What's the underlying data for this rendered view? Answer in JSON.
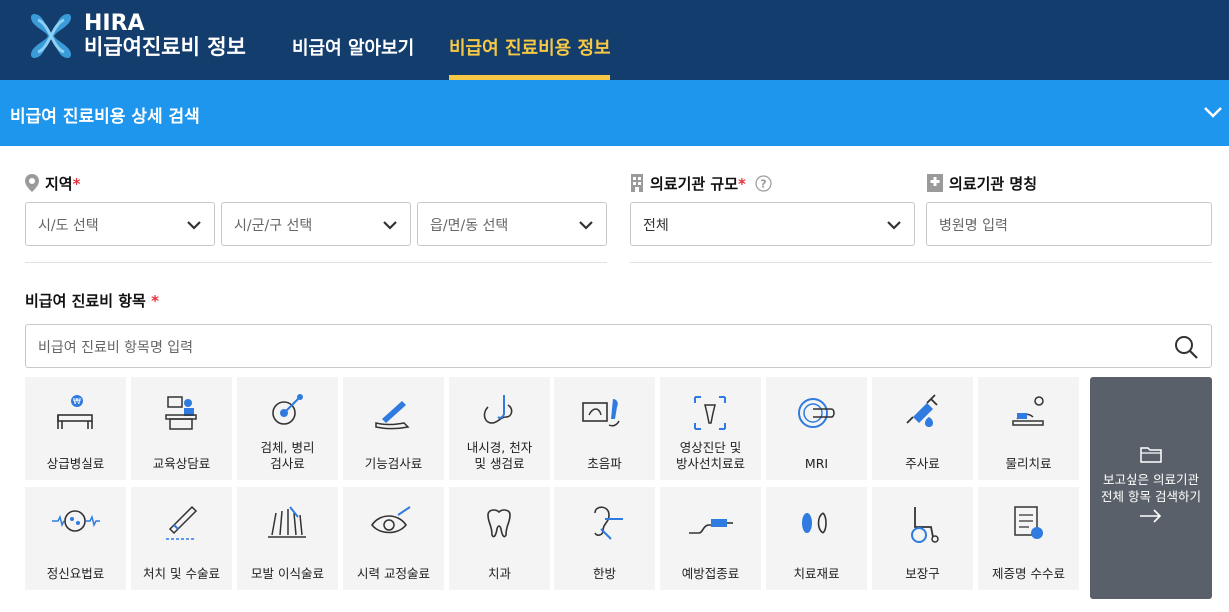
{
  "header": {
    "brand_line1": "HIRA",
    "brand_line2": "비급여진료비 정보",
    "nav": [
      {
        "label": "비급여 알아보기",
        "active": false
      },
      {
        "label": "비급여 진료비용 정보",
        "active": true
      }
    ]
  },
  "search_panel": {
    "title": "비급여 진료비용 상세 검색",
    "region": {
      "label": "지역",
      "required": "*",
      "sido_placeholder": "시/도 선택",
      "sigungu_placeholder": "시/군/구 선택",
      "dong_placeholder": "읍/면/동 선택"
    },
    "scale": {
      "label": "의료기관 규모",
      "required": "*",
      "value": "전체"
    },
    "name": {
      "label": "의료기관 명칭",
      "placeholder": "병원명 입력"
    },
    "item": {
      "label": "비급여 진료비 항목",
      "required": "*",
      "placeholder": "비급여 진료비 항목명 입력"
    }
  },
  "categories_row1": [
    {
      "label": "상급병실료",
      "icon": "bed-icon"
    },
    {
      "label": "교육상담료",
      "icon": "counsel-icon"
    },
    {
      "label": "검체, 병리\n검사료",
      "icon": "specimen-icon"
    },
    {
      "label": "기능검사료",
      "icon": "function-test-icon"
    },
    {
      "label": "내시경, 천자\n및 생검료",
      "icon": "endoscope-icon"
    },
    {
      "label": "초음파",
      "icon": "ultrasound-icon"
    },
    {
      "label": "영상진단 및\n방사선치료료",
      "icon": "imaging-icon"
    },
    {
      "label": "MRI",
      "icon": "mri-icon"
    },
    {
      "label": "주사료",
      "icon": "syringe-icon"
    },
    {
      "label": "물리치료",
      "icon": "physio-icon"
    }
  ],
  "categories_row2": [
    {
      "label": "정신요법료",
      "icon": "brain-icon"
    },
    {
      "label": "처치 및 수술료",
      "icon": "surgery-icon"
    },
    {
      "label": "모발 이식술료",
      "icon": "hair-icon"
    },
    {
      "label": "시력 교정술료",
      "icon": "eye-icon"
    },
    {
      "label": "치과",
      "icon": "tooth-icon"
    },
    {
      "label": "한방",
      "icon": "acupuncture-icon"
    },
    {
      "label": "예방접종료",
      "icon": "vaccine-icon"
    },
    {
      "label": "치료재료",
      "icon": "material-icon"
    },
    {
      "label": "보장구",
      "icon": "wheelchair-icon"
    },
    {
      "label": "제증명 수수료",
      "icon": "certificate-icon"
    }
  ],
  "all_button": {
    "label": "보고싶은 의료기관\n전체 항목 검색하기"
  },
  "colors": {
    "header_bg": "#123d6d",
    "panel_bar": "#1e96ee",
    "active_nav": "#f6c845",
    "required": "#e8303b",
    "icon_blue": "#2f7be0"
  }
}
